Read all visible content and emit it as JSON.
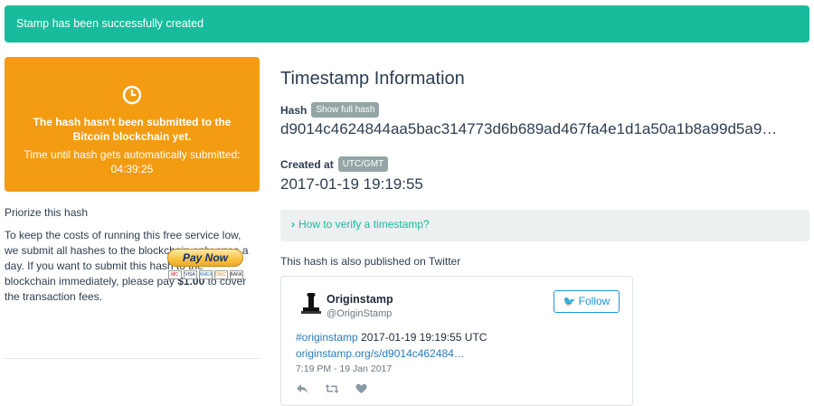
{
  "alert": {
    "message": "Stamp has been successfully created"
  },
  "status": {
    "line1": "The hash hasn't been submitted to the Bitcoin blockchain yet.",
    "line2": "Time until hash gets automatically submitted:",
    "countdown": "04:39:25",
    "color": "#f39c12",
    "icon": "clock-icon"
  },
  "priorize": {
    "title": "Priorize this hash",
    "text_before": "To keep the costs of running this free service low, we submit all hashes to the blockchain only once a day. If you want to submit this hash to the blockchain immediately, please pay ",
    "price": "$1.00",
    "text_after": " to cover the transaction fees.",
    "paynow_label": "Pay Now",
    "cards": [
      "MC",
      "VISA",
      "AMEX",
      "DISC",
      "BANK"
    ]
  },
  "info": {
    "title": "Timestamp Information",
    "hash_label": "Hash",
    "show_full_hash_label": "Show full hash",
    "hash_value": "d9014c4624844aa5bac314773d6b689ad467fa4e1d1a50a1b8a99d5a9…",
    "created_label": "Created at",
    "timezone_label": "UTC/GMT",
    "created_value": "2017-01-19 19:19:55",
    "verify_label": "How to verify a timestamp?",
    "twitter_label": "This hash is also published on Twitter"
  },
  "tweet": {
    "name": "Originstamp",
    "handle": "@OriginStamp",
    "follow_label": "Follow",
    "hashtag": "#originstamp",
    "text": " 2017-01-19 19:19:55 UTC",
    "link": "originstamp.org/s/d9014c462484…",
    "date": "7:19 PM - 19 Jan 2017",
    "icons": [
      "reply-icon",
      "retweet-icon",
      "like-icon"
    ]
  },
  "colors": {
    "accent": "#18bc9c",
    "warning": "#f39c12",
    "twitter": "#1b95e0"
  }
}
